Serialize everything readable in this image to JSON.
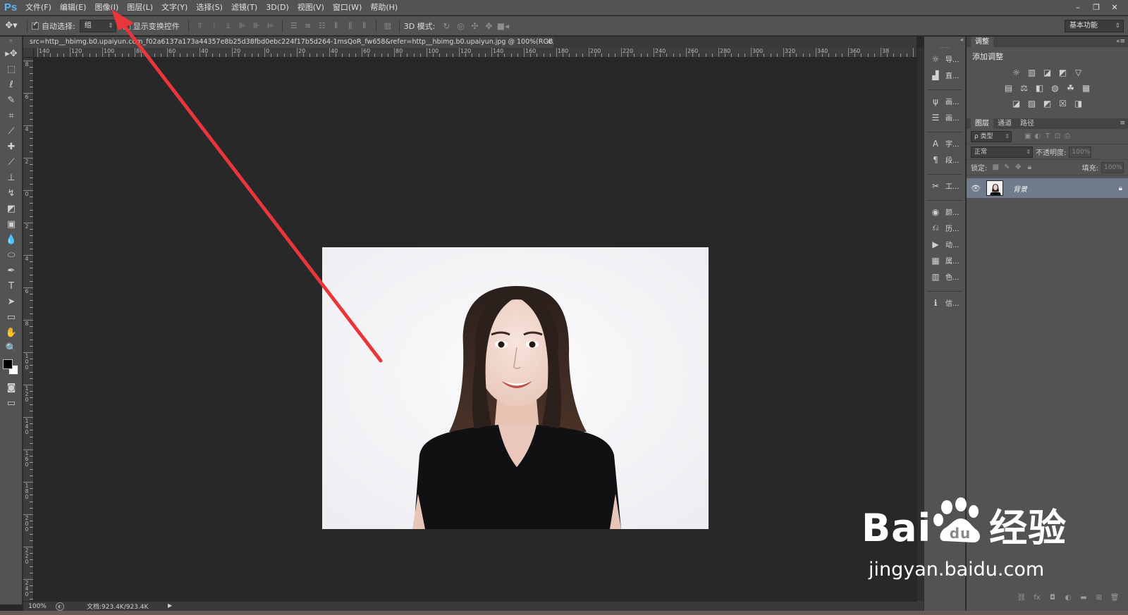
{
  "app": {
    "logo": "Ps",
    "menu": [
      "文件(F)",
      "编辑(E)",
      "图像(I)",
      "图层(L)",
      "文字(Y)",
      "选择(S)",
      "滤镜(T)",
      "3D(D)",
      "视图(V)",
      "窗口(W)",
      "帮助(H)"
    ],
    "window_controls": [
      "–",
      "❐",
      "✕"
    ]
  },
  "options_bar": {
    "auto_select_label": "自动选择:",
    "auto_select_checked": true,
    "auto_select_value": "组",
    "show_transform_label": "显示变换控件",
    "show_transform_checked": false,
    "mode_3d_label": "3D 模式:",
    "workspace": "基本功能"
  },
  "document": {
    "tab_title": "src=http__hbimg.b0.upaiyun.com_f02a6137a173a44357e8b25d38fbd0ebc224f17b5d264-1msQoR_fw658&refer=http__hbimg.b0.upaiyun.jpg @ 100%(RGB/8#)",
    "close_label": "×",
    "zoom": "100%",
    "doc_size": "文档:923.4K/923.4K"
  },
  "rulers": {
    "horizontal": [
      "140",
      "120",
      "100",
      "80",
      "60",
      "40",
      "20",
      "0",
      "20",
      "40",
      "60",
      "80",
      "100",
      "120",
      "140",
      "160",
      "180",
      "200",
      "220",
      "240",
      "260",
      "280",
      "300",
      "320",
      "340",
      "360",
      "38"
    ],
    "vertical": [
      "8",
      "6",
      "4",
      "2",
      "0",
      "2",
      "4",
      "6",
      "8",
      "100",
      "120",
      "140",
      "160",
      "180",
      "200",
      "220",
      "240"
    ]
  },
  "dock": {
    "items": [
      {
        "icon": "☼",
        "label": "导..."
      },
      {
        "icon": "▟",
        "label": "直..."
      },
      {
        "icon": "ψ",
        "label": "画..."
      },
      {
        "icon": "☰",
        "label": "画..."
      },
      {
        "icon": "A",
        "label": "字..."
      },
      {
        "icon": "¶",
        "label": "段..."
      },
      {
        "icon": "✂",
        "label": "工..."
      },
      {
        "icon": "◉",
        "label": "颜..."
      },
      {
        "icon": "⎌",
        "label": "历..."
      },
      {
        "icon": "▶",
        "label": "动..."
      },
      {
        "icon": "▦",
        "label": "属..."
      },
      {
        "icon": "▥",
        "label": "色..."
      },
      {
        "icon": "ℹ",
        "label": "信..."
      }
    ]
  },
  "adjustments": {
    "tab": "调整",
    "title": "添加调整",
    "rows": [
      [
        "☼",
        "▥",
        "◪",
        "◩",
        "▽"
      ],
      [
        "▤",
        "⚖",
        "◧",
        "◍",
        "☘",
        "▦"
      ],
      [
        "◪",
        "▨",
        "◩",
        "☒",
        "◨"
      ]
    ]
  },
  "layers": {
    "tabs": [
      "图层",
      "通道",
      "路径"
    ],
    "filter_label": "ρ 类型",
    "blend_mode": "正常",
    "opacity_label": "不透明度:",
    "opacity_value": "100%",
    "lock_label": "锁定:",
    "fill_label": "填充:",
    "fill_value": "100%",
    "layer_name": "背景"
  },
  "watermark": {
    "brand": "Bai",
    "brand_cn": "经验",
    "url": "jingyan.baidu.com"
  },
  "colors": {
    "arrow": "#e8363a",
    "ps_blue": "#5ab6f2",
    "selected_layer": "#6f7a8a"
  }
}
